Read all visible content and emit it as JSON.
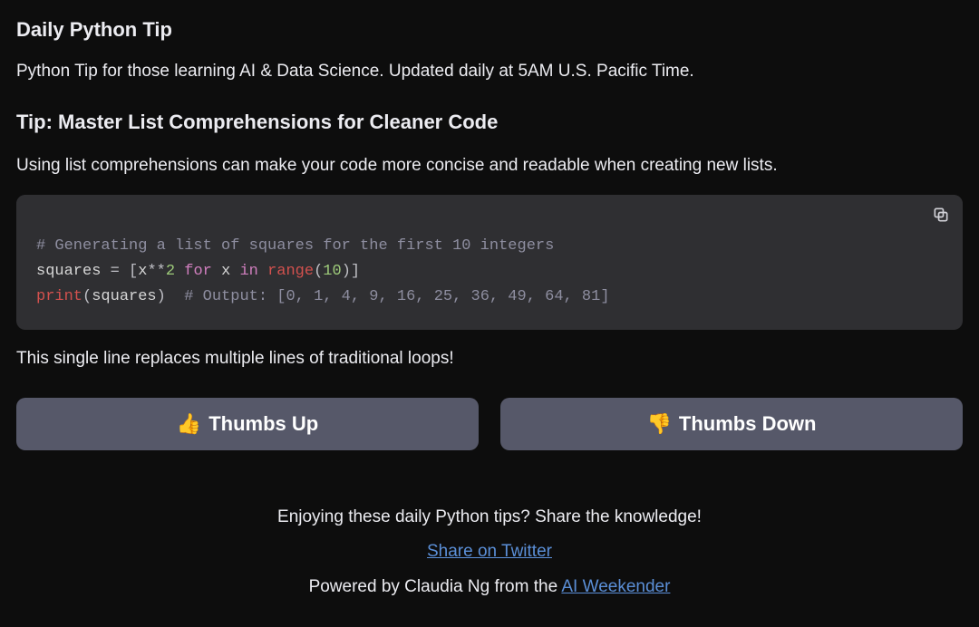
{
  "header": {
    "section_title": "Daily Python Tip",
    "lead": "Python Tip for those learning AI & Data Science. Updated daily at 5AM U.S. Pacific Time."
  },
  "tip": {
    "title": "Tip: Master List Comprehensions for Cleaner Code",
    "intro": "Using list comprehensions can make your code more concise and readable when creating new lists.",
    "code": {
      "line1_comment": "# Generating a list of squares for the first 10 integers",
      "l2_ident1": "squares",
      "l2_op1": " = [",
      "l2_ident2": "x",
      "l2_op2": "**",
      "l2_num1": "2",
      "l2_kw1": " for ",
      "l2_ident3": "x",
      "l2_kw2": " in ",
      "l2_builtin1": "range",
      "l2_op3": "(",
      "l2_num2": "10",
      "l2_op4": ")]",
      "l3_builtin1": "print",
      "l3_op1": "(",
      "l3_ident1": "squares",
      "l3_op2": ")  ",
      "l3_comment": "# Output: [0, 1, 4, 9, 16, 25, 36, 49, 64, 81]"
    },
    "outro": "This single line replaces multiple lines of traditional loops!"
  },
  "buttons": {
    "up_emoji": "👍",
    "up_label": "Thumbs Up",
    "down_emoji": "👎",
    "down_label": "Thumbs Down"
  },
  "footer": {
    "share_prompt": "Enjoying these daily Python tips? Share the knowledge!",
    "share_link_text": "Share on Twitter",
    "powered_prefix": "Powered by Claudia Ng from the ",
    "powered_link_text": "AI Weekender"
  }
}
